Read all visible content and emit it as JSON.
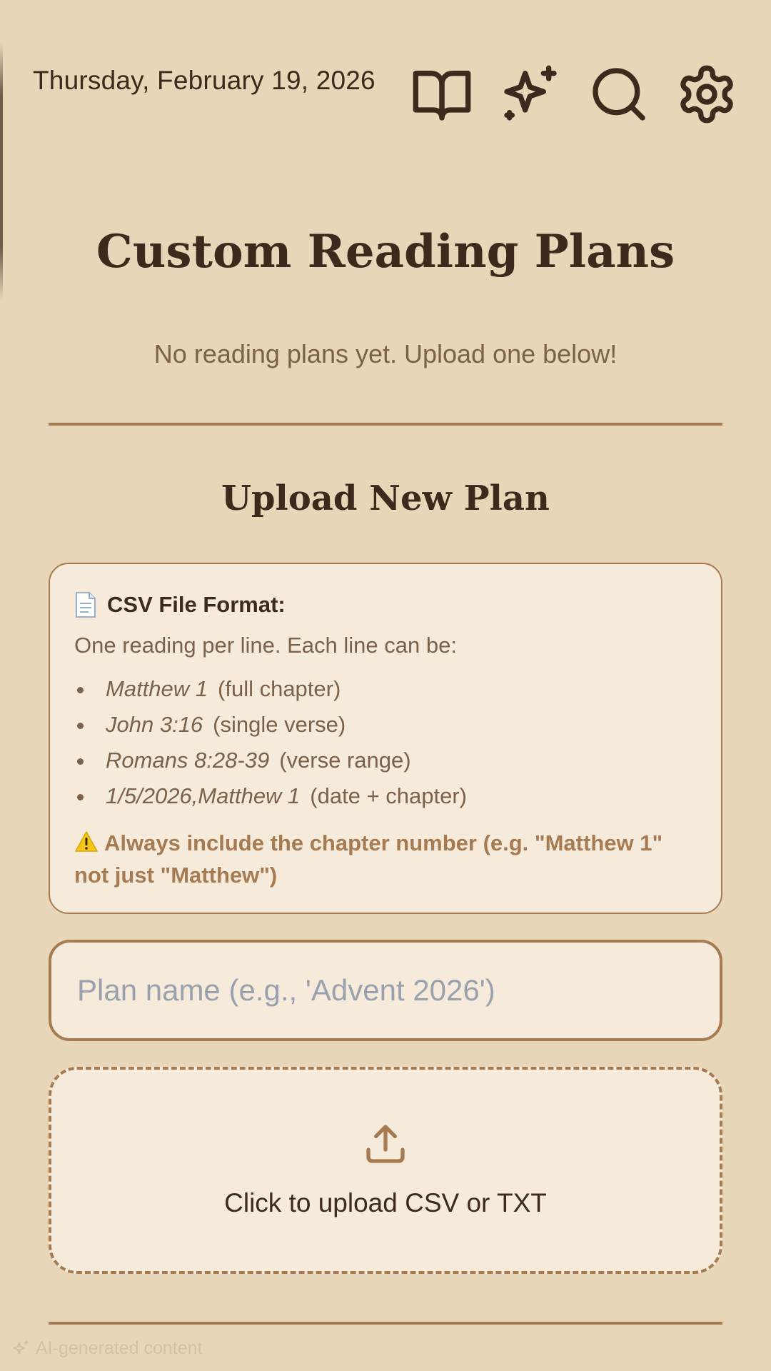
{
  "header": {
    "date": "Thursday, February 19, 2026",
    "icons": [
      "book-icon",
      "sparkles-icon",
      "search-icon",
      "gear-icon"
    ]
  },
  "main": {
    "title": "Custom Reading Plans",
    "empty_message": "No reading plans yet. Upload one below!"
  },
  "upload": {
    "heading": "Upload New Plan",
    "format": {
      "title": "CSV File Format:",
      "intro": "One reading per line. Each line can be:",
      "examples": [
        {
          "example": "Matthew 1",
          "note": "(full chapter)"
        },
        {
          "example": "John 3:16",
          "note": "(single verse)"
        },
        {
          "example": "Romans 8:28-39",
          "note": "(verse range)"
        },
        {
          "example": "1/5/2026,Matthew 1",
          "note": "(date + chapter)"
        }
      ],
      "warning": "Always include the chapter number (e.g. \"Matthew 1\" not just \"Matthew\")"
    },
    "name_placeholder": "Plan name (e.g., 'Advent 2026')",
    "name_value": "",
    "upload_label": "Click to upload CSV or TXT"
  },
  "footer": {
    "ai_note": "AI-generated content"
  },
  "colors": {
    "background": "#e8d6b9",
    "card": "#f6ebdb",
    "accent": "#a67b52",
    "text_dark": "#3d2a1c",
    "text_muted": "#7a6148",
    "placeholder": "#9aa1ae"
  }
}
